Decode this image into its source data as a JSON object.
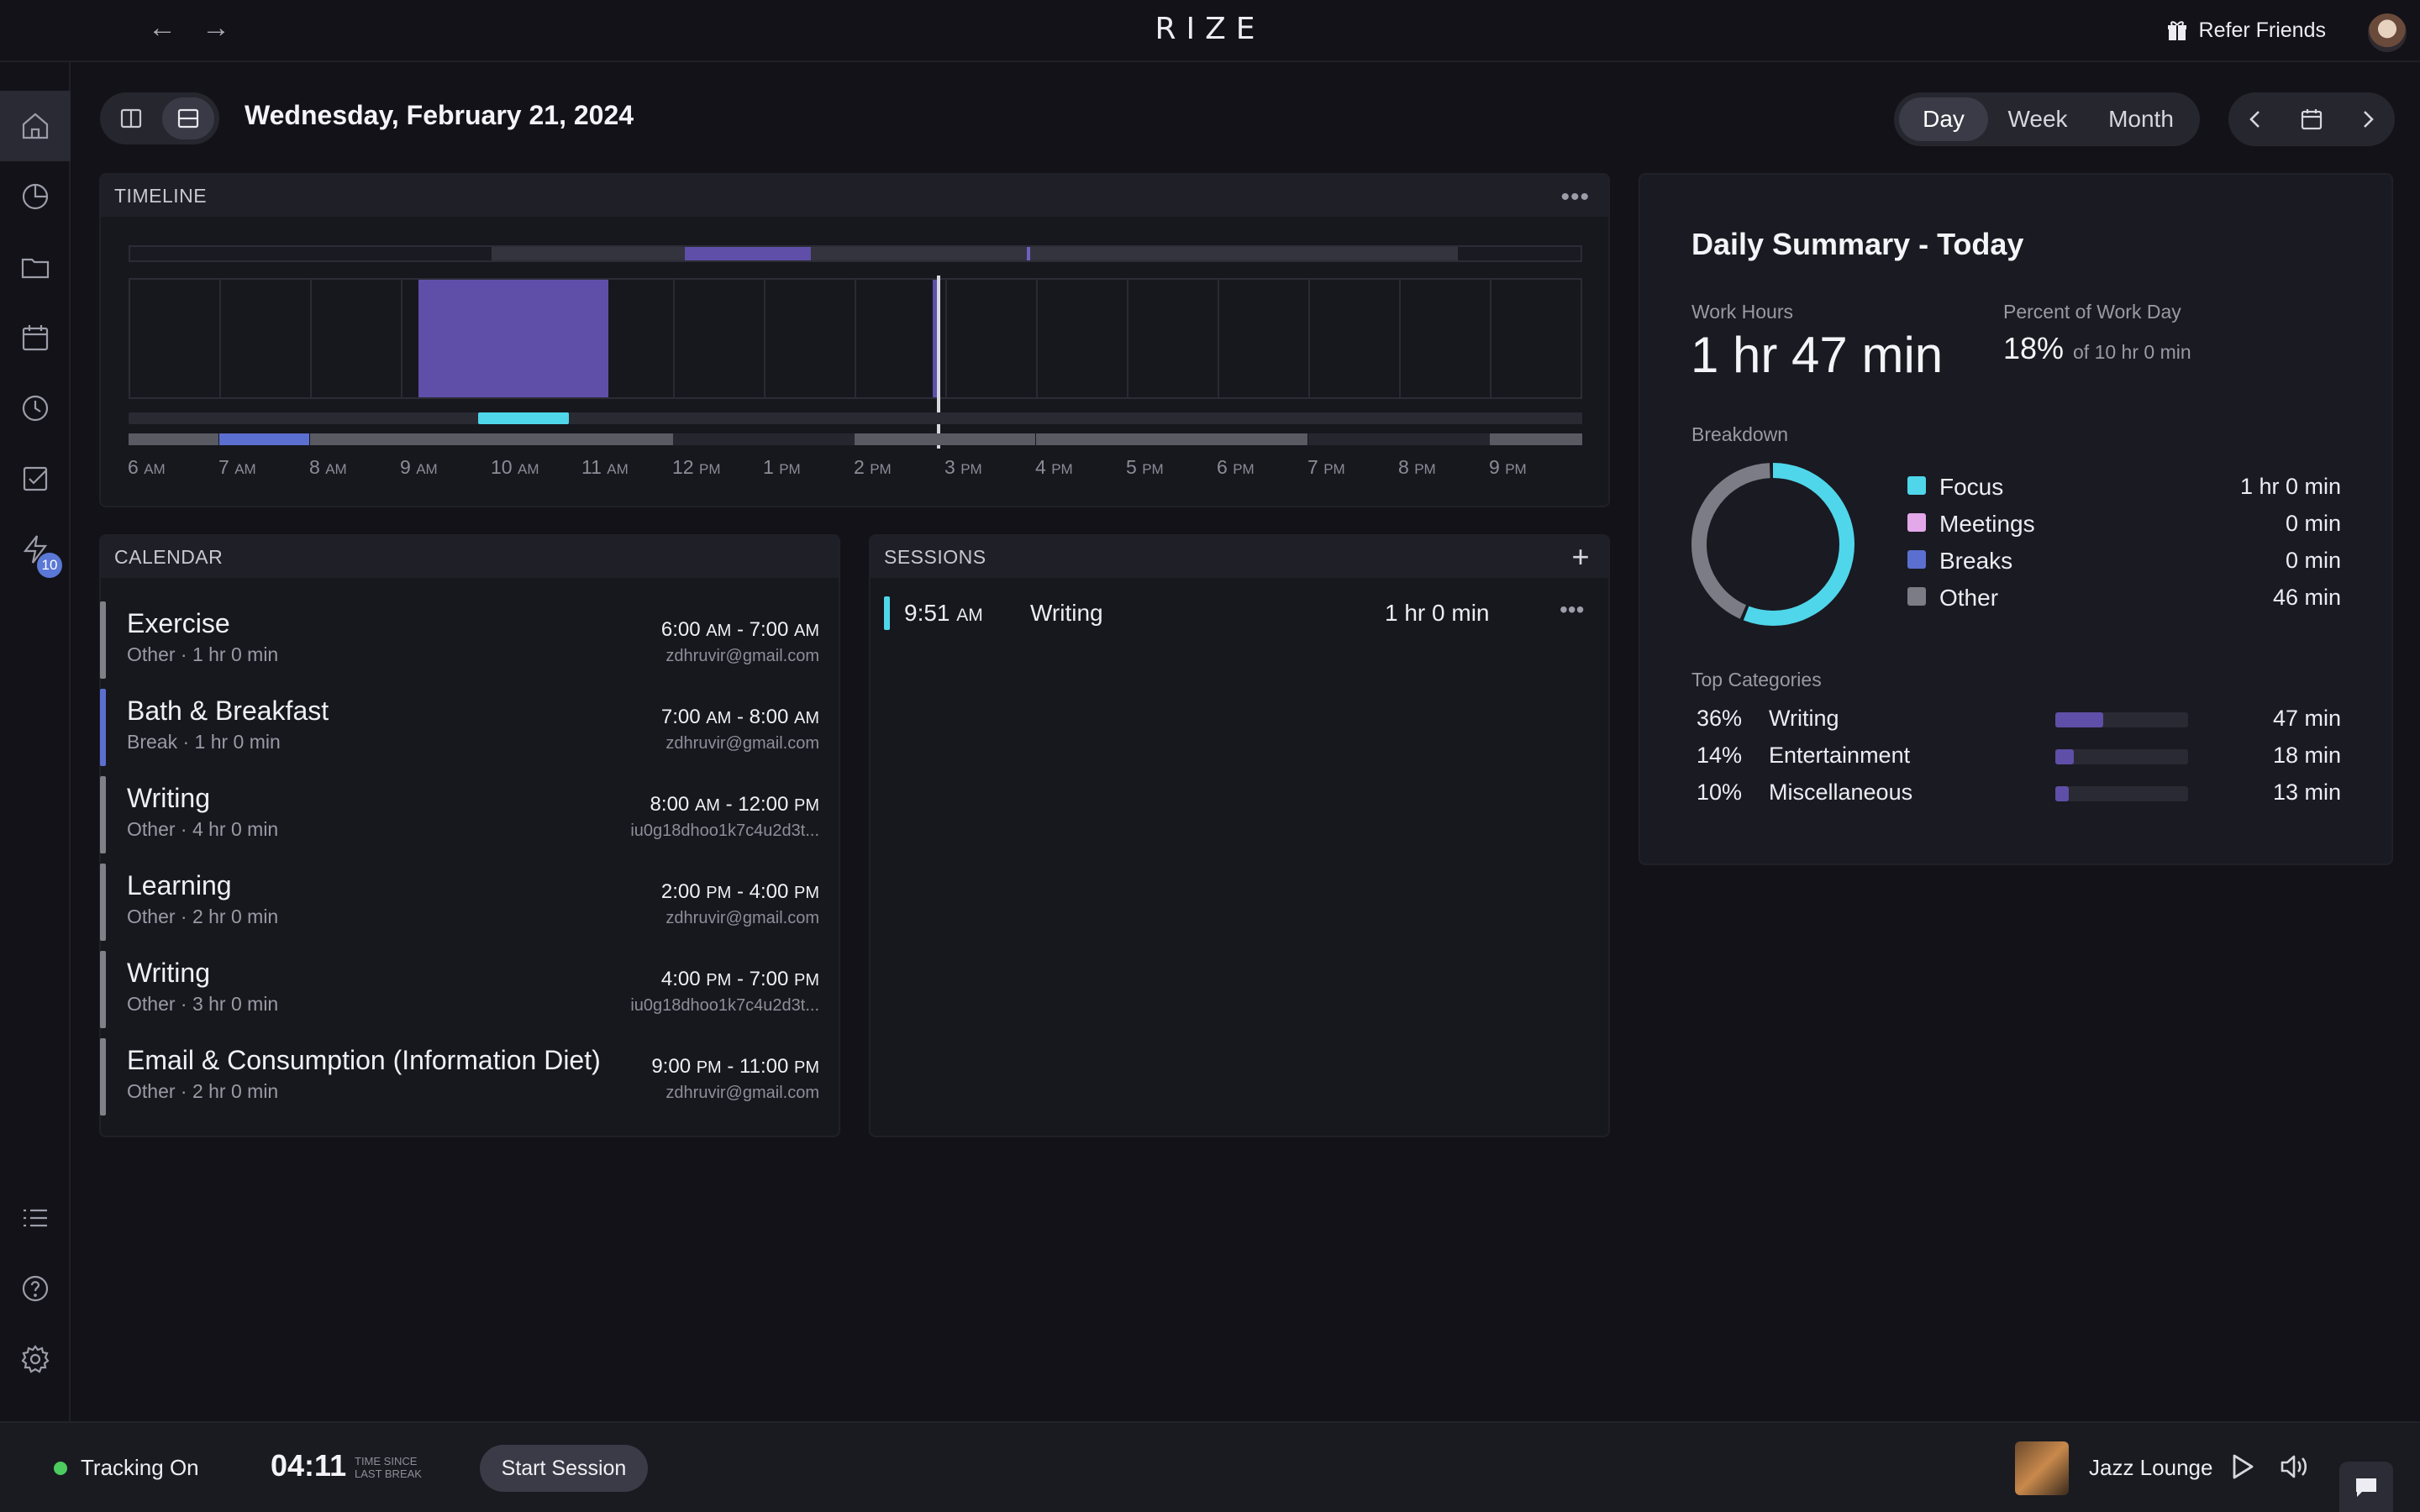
{
  "app": {
    "name": "RIZE"
  },
  "topbar": {
    "back": "←",
    "forward": "→",
    "refer_label": "Refer Friends"
  },
  "sidebar": {
    "badge_count": "10"
  },
  "header": {
    "date": "Wednesday, February 21, 2024",
    "range_options": [
      "Day",
      "Week",
      "Month"
    ],
    "range_selected": "Day"
  },
  "timeline": {
    "title": "TIMELINE",
    "ticks": [
      {
        "num": "6",
        "ampm": "AM"
      },
      {
        "num": "7",
        "ampm": "AM"
      },
      {
        "num": "8",
        "ampm": "AM"
      },
      {
        "num": "9",
        "ampm": "AM"
      },
      {
        "num": "10",
        "ampm": "AM"
      },
      {
        "num": "11",
        "ampm": "AM"
      },
      {
        "num": "12",
        "ampm": "PM"
      },
      {
        "num": "1",
        "ampm": "PM"
      },
      {
        "num": "2",
        "ampm": "PM"
      },
      {
        "num": "3",
        "ampm": "PM"
      },
      {
        "num": "4",
        "ampm": "PM"
      },
      {
        "num": "5",
        "ampm": "PM"
      },
      {
        "num": "6",
        "ampm": "PM"
      },
      {
        "num": "7",
        "ampm": "PM"
      },
      {
        "num": "8",
        "ampm": "PM"
      },
      {
        "num": "9",
        "ampm": "PM"
      }
    ]
  },
  "calendar": {
    "title": "CALENDAR",
    "events": [
      {
        "title": "Exercise",
        "sub": "Other  ·  1 hr 0 min",
        "start": "6:00",
        "start_ampm": "AM",
        "end": "7:00",
        "end_ampm": "AM",
        "account": "zdhruvir@gmail.com",
        "color": "#808088"
      },
      {
        "title": "Bath & Breakfast",
        "sub": "Break  ·  1 hr 0 min",
        "start": "7:00",
        "start_ampm": "AM",
        "end": "8:00",
        "end_ampm": "AM",
        "account": "zdhruvir@gmail.com",
        "color": "#5b6fd0"
      },
      {
        "title": "Writing",
        "sub": "Other  ·  4 hr 0 min",
        "start": "8:00",
        "start_ampm": "AM",
        "end": "12:00",
        "end_ampm": "PM",
        "account": "iu0g18dhoo1k7c4u2d3t...",
        "color": "#808088"
      },
      {
        "title": "Learning",
        "sub": "Other  ·  2 hr 0 min",
        "start": "2:00",
        "start_ampm": "PM",
        "end": "4:00",
        "end_ampm": "PM",
        "account": "zdhruvir@gmail.com",
        "color": "#808088"
      },
      {
        "title": "Writing",
        "sub": "Other  ·  3 hr 0 min",
        "start": "4:00",
        "start_ampm": "PM",
        "end": "7:00",
        "end_ampm": "PM",
        "account": "iu0g18dhoo1k7c4u2d3t...",
        "color": "#808088"
      },
      {
        "title": "Email & Consumption (Information Diet)",
        "sub": "Other  ·  2 hr 0 min",
        "start": "9:00",
        "start_ampm": "PM",
        "end": "11:00",
        "end_ampm": "PM",
        "account": "zdhruvir@gmail.com",
        "color": "#808088"
      }
    ]
  },
  "sessions": {
    "title": "SESSIONS",
    "add": "+",
    "items": [
      {
        "time": "9:51",
        "ampm": "AM",
        "name": "Writing",
        "duration": "1 hr 0 min",
        "color": "#4fd6ea"
      }
    ]
  },
  "summary": {
    "title": "Daily Summary - Today",
    "work_hours_label": "Work Hours",
    "work_hours": "1 hr 47 min",
    "percent_label": "Percent of Work Day",
    "percent": "18%",
    "percent_of": "of 10 hr 0 min",
    "breakdown_label": "Breakdown",
    "breakdown": [
      {
        "name": "Focus",
        "value": "1 hr 0 min",
        "color": "#4fd6ea",
        "minutes": 60
      },
      {
        "name": "Meetings",
        "value": "0 min",
        "color": "#e3a8ea",
        "minutes": 0
      },
      {
        "name": "Breaks",
        "value": "0 min",
        "color": "#5b6fd0",
        "minutes": 0
      },
      {
        "name": "Other",
        "value": "46 min",
        "color": "#7c7c86",
        "minutes": 46
      }
    ],
    "categories_label": "Top Categories",
    "categories": [
      {
        "pct": "36%",
        "name": "Writing",
        "time": "47 min",
        "fraction": 0.36
      },
      {
        "pct": "14%",
        "name": "Entertainment",
        "time": "18 min",
        "fraction": 0.14
      },
      {
        "pct": "10%",
        "name": "Miscellaneous",
        "time": "13 min",
        "fraction": 0.1
      }
    ]
  },
  "bottombar": {
    "tracking": "Tracking On",
    "timer": "04:11",
    "timer_caption_1": "TIME SINCE",
    "timer_caption_2": "LAST BREAK",
    "start_session": "Start Session",
    "music": "Jazz Lounge"
  },
  "colors": {
    "accent_purple": "#5f4fa8",
    "focus_cyan": "#4fd6ea",
    "break_blue": "#5b6fd0"
  }
}
